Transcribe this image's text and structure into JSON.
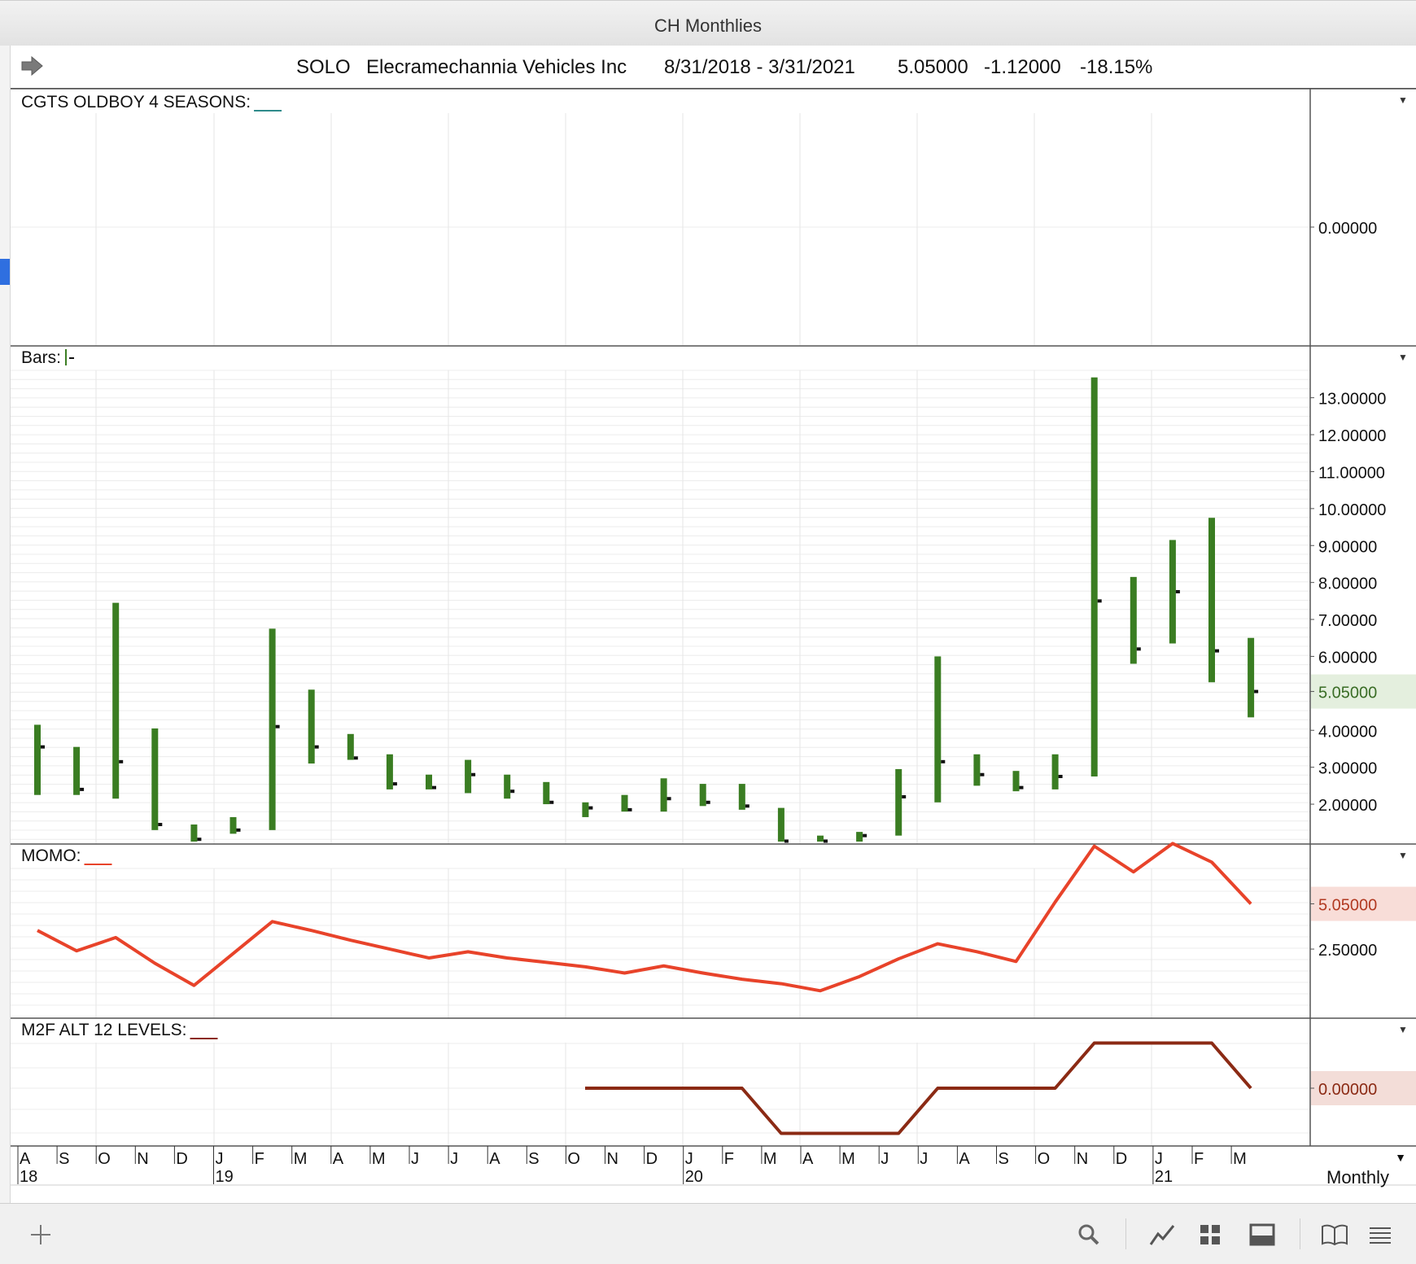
{
  "window": {
    "title": "CH Monthlies"
  },
  "header": {
    "symbol": "SOLO",
    "company": "Elecramechannia Vehicles Inc",
    "date_range": "8/31/2018 - 3/31/2021",
    "last": "5.05000",
    "change": "-1.12000",
    "change_pct": "-18.15%"
  },
  "panes": {
    "seasons": {
      "label": "CGTS OLDBOY 4 SEASONS:",
      "value_label": "0.00000",
      "line_color": "#2e8b8b"
    },
    "bars": {
      "label": "Bars:",
      "value_label": "5.05000",
      "up_color": "#3a7d22"
    },
    "momo": {
      "label": "MOMO:",
      "value_label": "5.05000",
      "tick_label": "2.50000",
      "line_color": "#e8432a"
    },
    "m2f": {
      "label": "M2F ALT 12 LEVELS:",
      "value_label": "0.00000",
      "line_color": "#8b2a14"
    }
  },
  "time_axis": {
    "months": [
      "A",
      "S",
      "O",
      "N",
      "D",
      "J",
      "F",
      "M",
      "A",
      "M",
      "J",
      "J",
      "A",
      "S",
      "O",
      "N",
      "D",
      "J",
      "F",
      "M",
      "A",
      "M",
      "J",
      "J",
      "A",
      "S",
      "O",
      "N",
      "D",
      "J",
      "F",
      "M"
    ],
    "years": [
      {
        "label": "18",
        "index": 0
      },
      {
        "label": "19",
        "index": 5
      },
      {
        "label": "20",
        "index": 17
      },
      {
        "label": "21",
        "index": 29
      }
    ]
  },
  "timeframe": {
    "label": "Monthly"
  },
  "toolbar": {
    "icons": [
      "add-icon",
      "search-icon",
      "line-chart-icon",
      "grid-icon",
      "panel-icon",
      "book-icon",
      "menu-icon"
    ]
  },
  "chart_data": [
    {
      "type": "line",
      "title": "CGTS OLDBOY 4 SEASONS",
      "yticks": [
        "0.00000"
      ],
      "series": []
    },
    {
      "type": "bar",
      "title": "Bars",
      "subtype": "ohlc-range",
      "x": [
        "Aug 2018",
        "Sep 2018",
        "Oct 2018",
        "Nov 2018",
        "Dec 2018",
        "Jan 2019",
        "Feb 2019",
        "Mar 2019",
        "Apr 2019",
        "May 2019",
        "Jun 2019",
        "Jul 2019",
        "Aug 2019",
        "Sep 2019",
        "Oct 2019",
        "Nov 2019",
        "Dec 2019",
        "Jan 2020",
        "Feb 2020",
        "Mar 2020",
        "Apr 2020",
        "May 2020",
        "Jun 2020",
        "Jul 2020",
        "Aug 2020",
        "Sep 2020",
        "Oct 2020",
        "Nov 2020",
        "Dec 2020",
        "Jan 2021",
        "Feb 2021",
        "Mar 2021"
      ],
      "high": [
        4.15,
        3.55,
        7.45,
        4.05,
        1.45,
        1.65,
        6.75,
        5.1,
        3.9,
        3.35,
        2.8,
        3.2,
        2.8,
        2.6,
        2.05,
        2.25,
        2.7,
        2.55,
        2.55,
        1.9,
        1.15,
        1.25,
        2.95,
        6.0,
        3.35,
        2.9,
        3.35,
        13.55,
        8.15,
        9.15,
        9.75,
        6.5
      ],
      "low": [
        2.25,
        2.25,
        2.15,
        1.3,
        0.95,
        1.2,
        1.3,
        3.1,
        3.2,
        2.4,
        2.4,
        2.3,
        2.15,
        2.0,
        1.65,
        1.8,
        1.8,
        1.95,
        1.85,
        0.9,
        0.95,
        0.95,
        1.15,
        2.05,
        2.5,
        2.35,
        2.4,
        2.75,
        5.8,
        6.35,
        5.3,
        4.35
      ],
      "close": [
        3.55,
        2.4,
        3.15,
        1.45,
        1.05,
        1.3,
        4.1,
        3.55,
        3.25,
        2.55,
        2.45,
        2.8,
        2.35,
        2.05,
        1.9,
        1.85,
        2.15,
        2.05,
        1.95,
        1.0,
        1.0,
        1.15,
        2.2,
        3.15,
        2.8,
        2.45,
        2.75,
        7.5,
        6.2,
        7.75,
        6.15,
        5.05
      ],
      "yticks": [
        2,
        3,
        4,
        5.05,
        6,
        7,
        8,
        9,
        10,
        11,
        12,
        13
      ],
      "ylim": [
        0.9,
        13.6
      ]
    },
    {
      "type": "line",
      "title": "MOMO",
      "x": [
        "Aug 2018",
        "Sep 2018",
        "Oct 2018",
        "Nov 2018",
        "Dec 2018",
        "Jan 2019",
        "Feb 2019",
        "Mar 2019",
        "Apr 2019",
        "May 2019",
        "Jun 2019",
        "Jul 2019",
        "Aug 2019",
        "Sep 2019",
        "Oct 2019",
        "Nov 2019",
        "Dec 2019",
        "Jan 2020",
        "Feb 2020",
        "Mar 2020",
        "Apr 2020",
        "May 2020",
        "Jun 2020",
        "Jul 2020",
        "Aug 2020",
        "Sep 2020",
        "Oct 2020",
        "Nov 2020",
        "Dec 2020",
        "Jan 2021",
        "Feb 2021",
        "Mar 2021"
      ],
      "values": [
        3.55,
        2.4,
        3.15,
        1.7,
        0.45,
        2.25,
        4.05,
        3.55,
        3.0,
        2.5,
        2.0,
        2.35,
        2.0,
        1.75,
        1.5,
        1.15,
        1.55,
        1.15,
        0.8,
        0.55,
        0.15,
        0.95,
        1.95,
        2.8,
        2.35,
        1.8,
        5.15,
        8.3,
        6.85,
        8.45,
        7.4,
        5.05
      ],
      "yticks": [
        2.5,
        5.05
      ],
      "ylim": [
        -1.35,
        9.4
      ]
    },
    {
      "type": "line",
      "title": "M2F ALT 12 LEVELS",
      "x": [
        "Oct 2019",
        "Nov 2019",
        "Dec 2019",
        "Jan 2020",
        "Feb 2020",
        "Mar 2020",
        "Apr 2020",
        "May 2020",
        "Jun 2020",
        "Jul 2020",
        "Aug 2020",
        "Sep 2020",
        "Oct 2020",
        "Nov 2020",
        "Dec 2020",
        "Jan 2021",
        "Feb 2021",
        "Mar 2021"
      ],
      "values": [
        0,
        0,
        0,
        0,
        0,
        -1,
        -1,
        -1,
        -1,
        0,
        0,
        0,
        0,
        1,
        1,
        1,
        1,
        0
      ],
      "yticks": [
        0
      ],
      "ylim": [
        -1.5,
        1.2
      ]
    }
  ]
}
